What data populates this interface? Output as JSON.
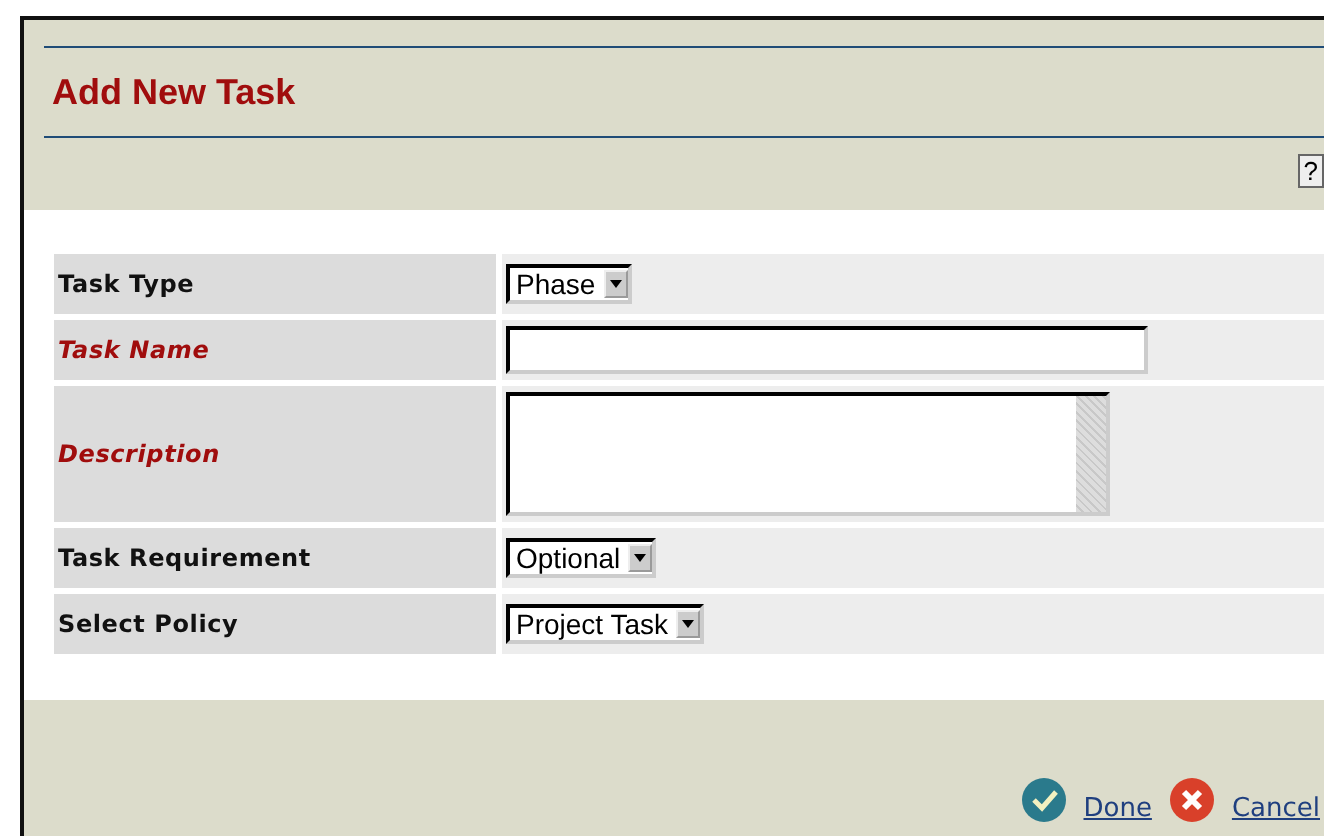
{
  "title": "Add New Task",
  "help": "?",
  "fields": [
    {
      "label": "Task Type",
      "required": false,
      "kind": "select",
      "value": "Phase"
    },
    {
      "label": "Task Name",
      "required": true,
      "kind": "text"
    },
    {
      "label": "Description",
      "required": true,
      "kind": "textarea"
    },
    {
      "label": "Task Requirement",
      "required": false,
      "kind": "select",
      "value": "Optional"
    },
    {
      "label": "Select Policy",
      "required": false,
      "kind": "select",
      "value": "Project Task"
    }
  ],
  "actions": [
    {
      "label": "Done",
      "kind": "done"
    },
    {
      "label": "Cancel",
      "kind": "cancel"
    }
  ]
}
